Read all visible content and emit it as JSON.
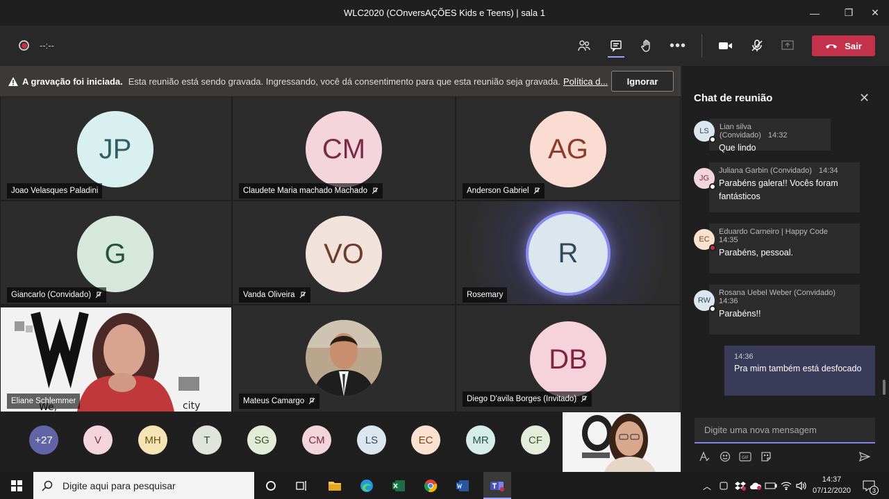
{
  "window": {
    "title": "WLC2020 (COnversAÇÕES Kids e Teens) | sala 1"
  },
  "toolbar": {
    "timer": "--:--",
    "leave_label": "Sair"
  },
  "banner": {
    "title": "A gravação foi iniciada.",
    "text": "Esta reunião está sendo gravada. Ingressando, você dá consentimento para que esta reunião seja gravada.",
    "link": "Política d...",
    "dismiss_label": "Ignorar"
  },
  "tiles": [
    {
      "initials": "JP",
      "name": "Joao Velasques Paladini",
      "bg": "#d9f0f0",
      "fg": "#2e5f63",
      "muted": false
    },
    {
      "initials": "CM",
      "name": "Claudete Maria machado Machado",
      "bg": "#f5d5dc",
      "fg": "#7a2b45",
      "muted": true
    },
    {
      "initials": "AG",
      "name": "Anderson Gabriel",
      "bg": "#fbdcd2",
      "fg": "#8a3b2a",
      "muted": true
    },
    {
      "initials": "G",
      "name": "Giancarlo (Convidado)",
      "bg": "#d6e8dc",
      "fg": "#245339",
      "muted": true
    },
    {
      "initials": "VO",
      "name": "Vanda Oliveira",
      "bg": "#f2e2dc",
      "fg": "#6c3d2c",
      "muted": true
    },
    {
      "initials": "R",
      "name": "Rosemary",
      "bg": "#dbe6ee",
      "fg": "#33495a",
      "muted": false
    },
    {
      "initials": "",
      "name": "Eliane Schlemmer",
      "bg": "",
      "fg": "",
      "muted": false
    },
    {
      "initials": "",
      "name": "Mateus Camargo",
      "bg": "",
      "fg": "",
      "muted": true
    },
    {
      "initials": "DB",
      "name": "Diego D'avila Borges (Invitado)",
      "bg": "#f6d3dc",
      "fg": "#7c2641",
      "muted": true
    }
  ],
  "strip": [
    {
      "initials": "+27",
      "bg": "#6264a7",
      "fg": "#ffffff"
    },
    {
      "initials": "V",
      "bg": "#f5d5dc",
      "fg": "#7a2b45"
    },
    {
      "initials": "MH",
      "bg": "#f6e4b5",
      "fg": "#6b4f13"
    },
    {
      "initials": "T",
      "bg": "#dfe4dd",
      "fg": "#37433a"
    },
    {
      "initials": "SG",
      "bg": "#e2ecd8",
      "fg": "#3b5426"
    },
    {
      "initials": "CM",
      "bg": "#f5d5dc",
      "fg": "#7a2b45"
    },
    {
      "initials": "LS",
      "bg": "#dbe6ee",
      "fg": "#33495a"
    },
    {
      "initials": "EC",
      "bg": "#fbe2d0",
      "fg": "#7d3f16"
    },
    {
      "initials": "MR",
      "bg": "#d6ece6",
      "fg": "#1f5548"
    },
    {
      "initials": "CF",
      "bg": "#e4eddc",
      "fg": "#3f5428"
    }
  ],
  "chat": {
    "title": "Chat de reunião",
    "messages": [
      {
        "initials": "LS",
        "author": "Lian silva (Convidado)",
        "time": "14:32",
        "text": "Que lindo",
        "av_bg": "#dbe6ee",
        "av_fg": "#33495a",
        "status": "#ffffff"
      },
      {
        "initials": "JG",
        "author": "Juliana Garbin (Convidado)",
        "time": "14:34",
        "text": "Parabéns galera!! Vocês foram fantásticos",
        "av_bg": "#f5d5dc",
        "av_fg": "#7a2b45",
        "status": "#ffffff"
      },
      {
        "initials": "EC",
        "author": "Eduardo Carneiro | Happy Code",
        "time": "14:35",
        "text": "Parabéns, pessoal.",
        "av_bg": "#fbe2d0",
        "av_fg": "#7d3f16",
        "status": "#c4314b"
      },
      {
        "initials": "RW",
        "author": "Rosana Uebel Weber (Convidado)",
        "time": "14:36",
        "text": "Parabéns!!",
        "av_bg": "#dbe6ee",
        "av_fg": "#33495a",
        "status": "#ffffff"
      }
    ],
    "own": {
      "time": "14:36",
      "text": "Pra mim também está desfocado"
    },
    "compose_placeholder": "Digite uma nova mensagem"
  },
  "taskbar": {
    "search_placeholder": "Digite aqui para pesquisar",
    "time": "14:37",
    "date": "07/12/2020",
    "notifications": "3"
  },
  "colors": {
    "accent": "#6264a7",
    "leave": "#c4314b"
  }
}
